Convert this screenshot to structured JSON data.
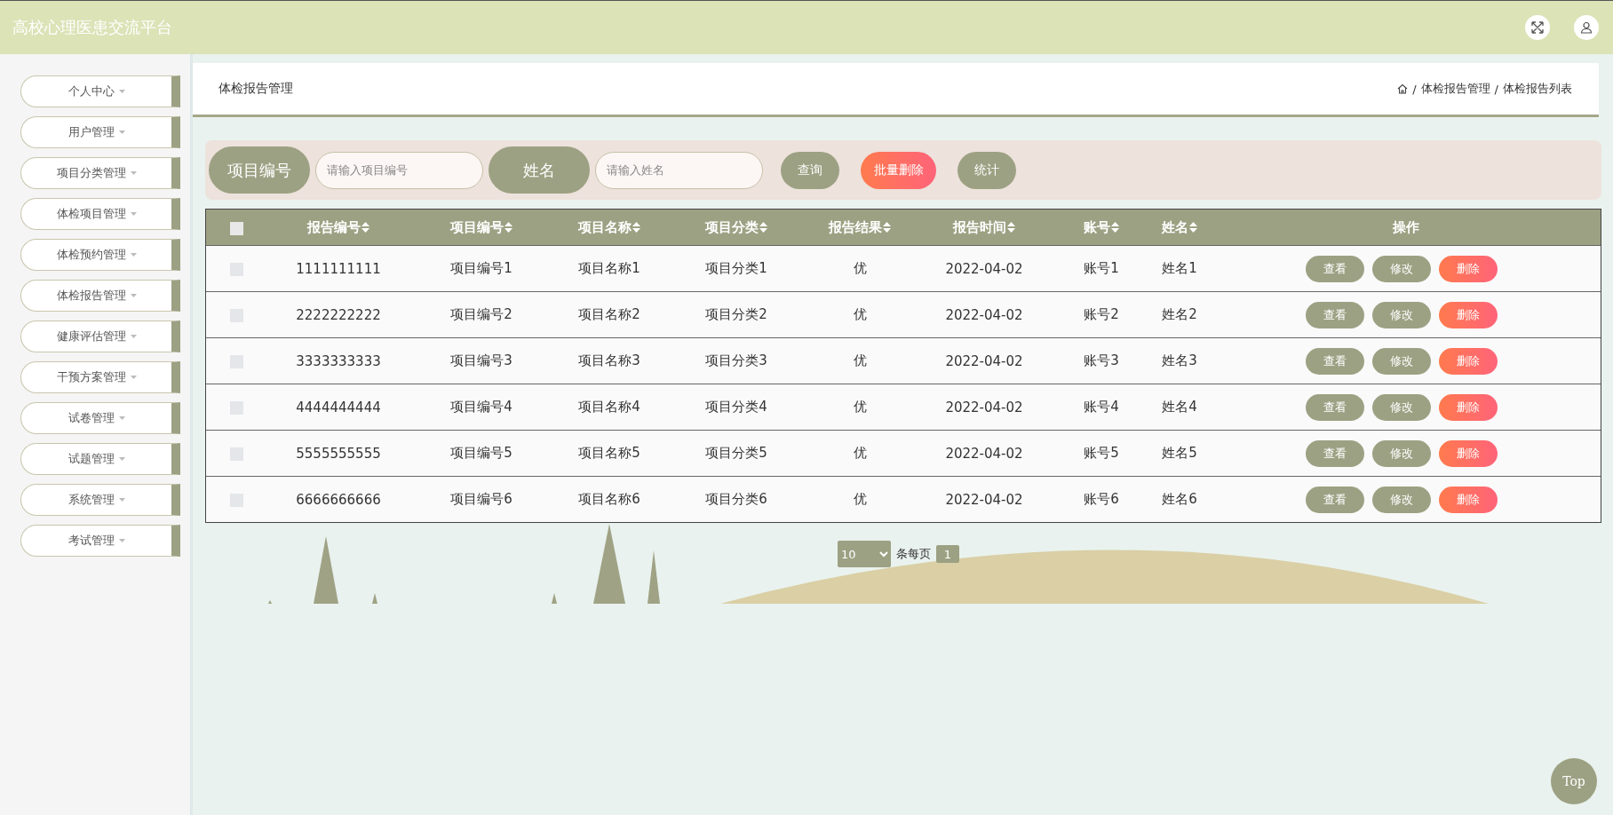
{
  "header": {
    "title": "高校心理医患交流平台"
  },
  "sidebar": {
    "items": [
      {
        "label": "个人中心"
      },
      {
        "label": "用户管理"
      },
      {
        "label": "项目分类管理"
      },
      {
        "label": "体检项目管理"
      },
      {
        "label": "体检预约管理"
      },
      {
        "label": "体检报告管理"
      },
      {
        "label": "健康评估管理"
      },
      {
        "label": "干预方案管理"
      },
      {
        "label": "试卷管理"
      },
      {
        "label": "试题管理"
      },
      {
        "label": "系统管理"
      },
      {
        "label": "考试管理"
      }
    ]
  },
  "breadcrumb": {
    "title": "体检报告管理",
    "crumbs": [
      {
        "separator": "/",
        "label": "体检报告管理"
      },
      {
        "separator": "/",
        "label": "体检报告列表"
      }
    ]
  },
  "search": {
    "fields": [
      {
        "label": "项目编号",
        "placeholder": "请输入项目编号"
      },
      {
        "label": "姓名",
        "placeholder": "请输入姓名"
      }
    ],
    "buttons": [
      {
        "label": "查询",
        "kind": "primary"
      },
      {
        "label": "批量删除",
        "kind": "danger"
      },
      {
        "label": "统计",
        "kind": "primary"
      }
    ]
  },
  "table": {
    "select_all": {
      "checked": false
    },
    "columns": [
      {
        "label": "报告编号",
        "sortable": true
      },
      {
        "label": "项目编号",
        "sortable": true
      },
      {
        "label": "项目名称",
        "sortable": true
      },
      {
        "label": "项目分类",
        "sortable": true
      },
      {
        "label": "报告结果",
        "sortable": true
      },
      {
        "label": "报告时间",
        "sortable": true
      },
      {
        "label": "账号",
        "sortable": true
      },
      {
        "label": "姓名",
        "sortable": true
      },
      {
        "label": "操作",
        "sortable": false
      }
    ],
    "rows": [
      {
        "checked": false,
        "cells": [
          "1111111111",
          "项目编号1",
          "项目名称1",
          "项目分类1",
          "优",
          "2022-04-02",
          "账号1",
          "姓名1"
        ],
        "actions": [
          {
            "label": "查看",
            "kind": "primary"
          },
          {
            "label": "修改",
            "kind": "primary"
          },
          {
            "label": "删除",
            "kind": "danger"
          }
        ]
      },
      {
        "checked": false,
        "cells": [
          "2222222222",
          "项目编号2",
          "项目名称2",
          "项目分类2",
          "优",
          "2022-04-02",
          "账号2",
          "姓名2"
        ],
        "actions": [
          {
            "label": "查看",
            "kind": "primary"
          },
          {
            "label": "修改",
            "kind": "primary"
          },
          {
            "label": "删除",
            "kind": "danger"
          }
        ]
      },
      {
        "checked": false,
        "cells": [
          "3333333333",
          "项目编号3",
          "项目名称3",
          "项目分类3",
          "优",
          "2022-04-02",
          "账号3",
          "姓名3"
        ],
        "actions": [
          {
            "label": "查看",
            "kind": "primary"
          },
          {
            "label": "修改",
            "kind": "primary"
          },
          {
            "label": "删除",
            "kind": "danger"
          }
        ]
      },
      {
        "checked": false,
        "cells": [
          "4444444444",
          "项目编号4",
          "项目名称4",
          "项目分类4",
          "优",
          "2022-04-02",
          "账号4",
          "姓名4"
        ],
        "actions": [
          {
            "label": "查看",
            "kind": "primary"
          },
          {
            "label": "修改",
            "kind": "primary"
          },
          {
            "label": "删除",
            "kind": "danger"
          }
        ]
      },
      {
        "checked": false,
        "cells": [
          "5555555555",
          "项目编号5",
          "项目名称5",
          "项目分类5",
          "优",
          "2022-04-02",
          "账号5",
          "姓名5"
        ],
        "actions": [
          {
            "label": "查看",
            "kind": "primary"
          },
          {
            "label": "修改",
            "kind": "primary"
          },
          {
            "label": "删除",
            "kind": "danger"
          }
        ]
      },
      {
        "checked": false,
        "cells": [
          "6666666666",
          "项目编号6",
          "项目名称6",
          "项目分类6",
          "优",
          "2022-04-02",
          "账号6",
          "姓名6"
        ],
        "actions": [
          {
            "label": "查看",
            "kind": "primary"
          },
          {
            "label": "修改",
            "kind": "primary"
          },
          {
            "label": "删除",
            "kind": "danger"
          }
        ]
      }
    ]
  },
  "pagination": {
    "page_size": "10",
    "per_page_label": "条每页",
    "pages": [
      {
        "label": "1",
        "selected": true
      }
    ]
  },
  "back_to_top": {
    "label": "Top"
  }
}
